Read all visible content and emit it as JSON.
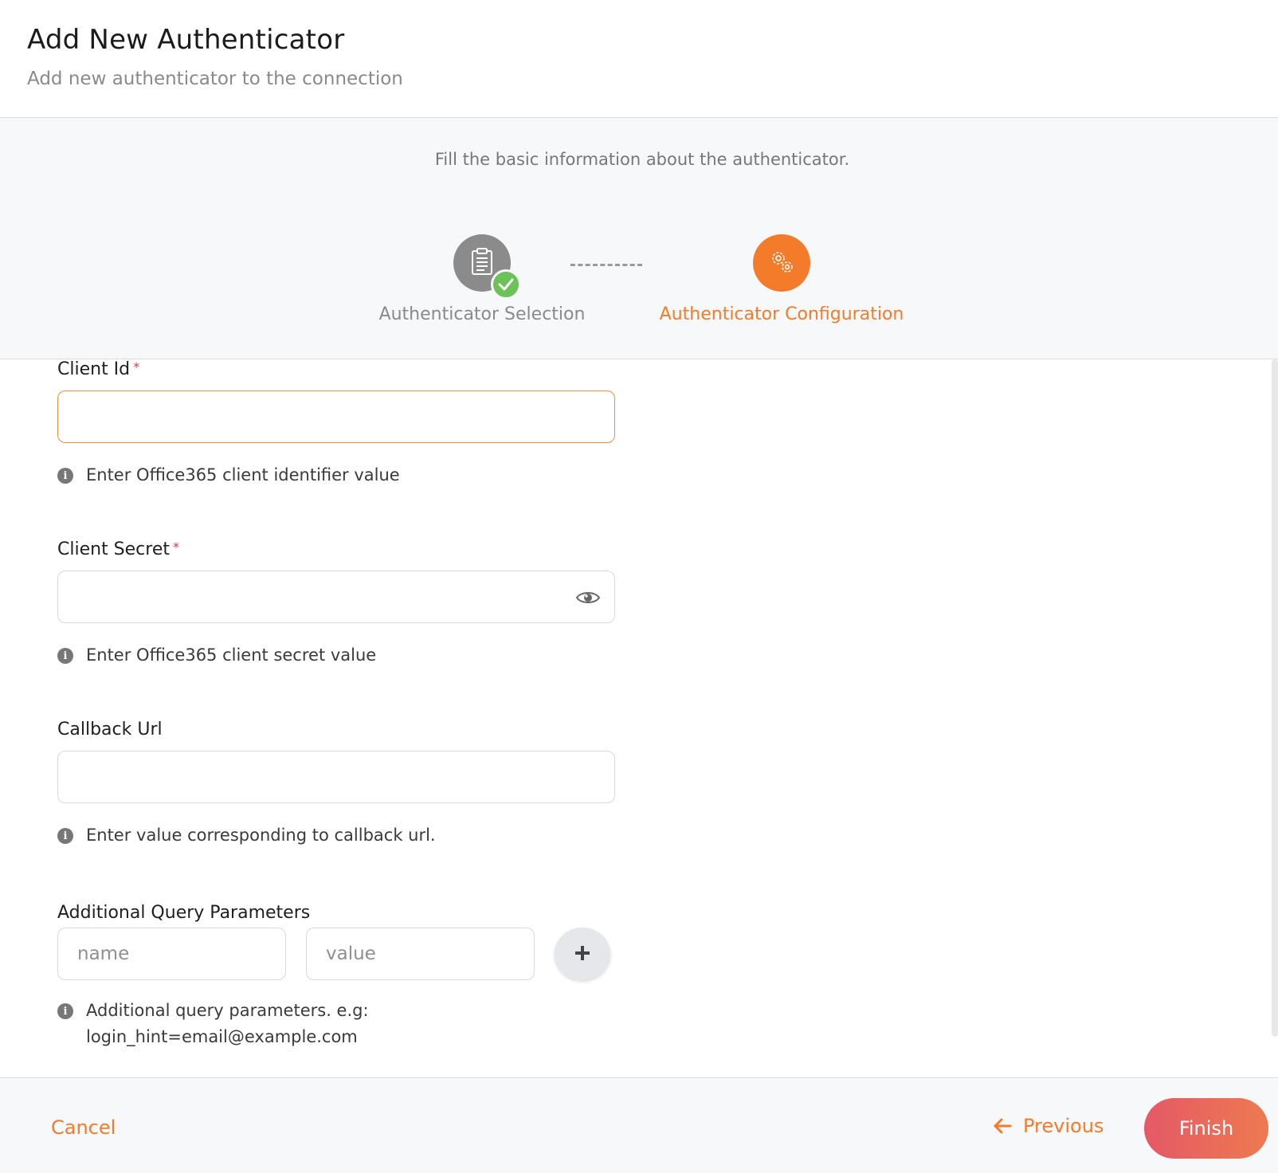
{
  "header": {
    "title": "Add New Authenticator",
    "subtitle": "Add new authenticator to the connection"
  },
  "wizard": {
    "hint": "Fill the basic information about the authenticator.",
    "steps": [
      {
        "label": "Authenticator Selection",
        "icon": "clipboard-icon",
        "status": "completed"
      },
      {
        "label": "Authenticator Configuration",
        "icon": "gears-icon",
        "status": "active"
      }
    ],
    "accent_color": "#f47b2a",
    "completed_color": "#6ac259"
  },
  "form": {
    "client_id": {
      "label": "Client Id",
      "required_mark": "*",
      "value": "",
      "help": "Enter Office365 client identifier value"
    },
    "client_secret": {
      "label": "Client Secret",
      "required_mark": "*",
      "value": "",
      "help": "Enter Office365 client secret value"
    },
    "callback_url": {
      "label": "Callback Url",
      "value": "",
      "help": "Enter value corresponding to callback url."
    },
    "query_params": {
      "label": "Additional Query Parameters",
      "name_placeholder": "name",
      "value_placeholder": "value",
      "help_line1": "Additional query parameters. e.g:",
      "help_line2": "login_hint=email@example.com"
    }
  },
  "footer": {
    "cancel_label": "Cancel",
    "previous_label": "Previous",
    "finish_label": "Finish"
  }
}
